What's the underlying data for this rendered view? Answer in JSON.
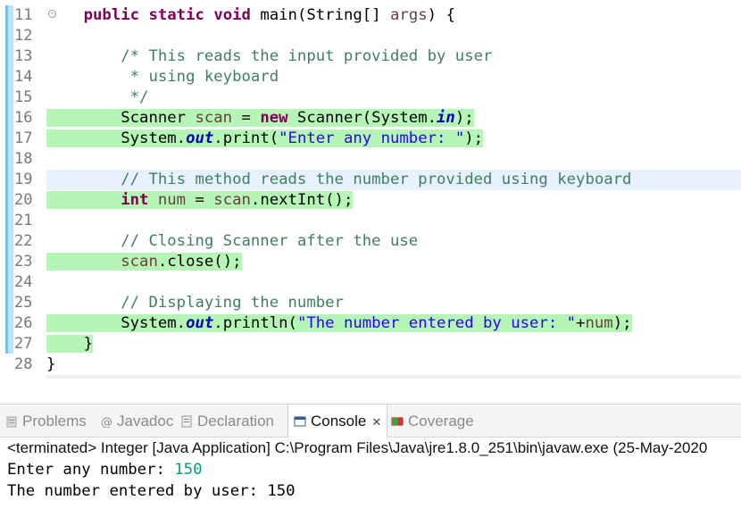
{
  "editor": {
    "lines": [
      {
        "num": "11",
        "segments": [
          {
            "t": "    "
          },
          {
            "t": "public",
            "c": "kw"
          },
          {
            "t": " "
          },
          {
            "t": "static",
            "c": "kw"
          },
          {
            "t": " "
          },
          {
            "t": "void",
            "c": "kw"
          },
          {
            "t": " main(String[] "
          },
          {
            "t": "args",
            "c": "var"
          },
          {
            "t": ") {"
          }
        ]
      },
      {
        "num": "12",
        "segments": []
      },
      {
        "num": "13",
        "segments": [
          {
            "t": "        "
          },
          {
            "t": "/* This reads the input provided by user",
            "c": "cm"
          }
        ]
      },
      {
        "num": "14",
        "segments": [
          {
            "t": "         "
          },
          {
            "t": "* using keyboard",
            "c": "cm"
          }
        ]
      },
      {
        "num": "15",
        "segments": [
          {
            "t": "         "
          },
          {
            "t": "*/",
            "c": "cm"
          }
        ]
      },
      {
        "num": "16",
        "hl": true,
        "segments": [
          {
            "t": "        Scanner "
          },
          {
            "t": "scan",
            "c": "var"
          },
          {
            "t": " = "
          },
          {
            "t": "new",
            "c": "kw"
          },
          {
            "t": " Scanner(System."
          },
          {
            "t": "in",
            "c": "fd"
          },
          {
            "t": ");"
          }
        ]
      },
      {
        "num": "17",
        "hl": true,
        "segments": [
          {
            "t": "        System."
          },
          {
            "t": "out",
            "c": "fd"
          },
          {
            "t": ".print("
          },
          {
            "t": "\"Enter any number: \"",
            "c": "st"
          },
          {
            "t": ");"
          }
        ]
      },
      {
        "num": "18",
        "segments": []
      },
      {
        "num": "19",
        "segments": [
          {
            "t": "        "
          },
          {
            "t": "// This method reads the number provided using keyboard",
            "c": "cm"
          }
        ]
      },
      {
        "num": "20",
        "hl": true,
        "segments": [
          {
            "t": "        "
          },
          {
            "t": "int",
            "c": "kw"
          },
          {
            "t": " "
          },
          {
            "t": "num",
            "c": "var"
          },
          {
            "t": " = "
          },
          {
            "t": "scan",
            "c": "var"
          },
          {
            "t": ".nextInt();"
          }
        ]
      },
      {
        "num": "21",
        "segments": []
      },
      {
        "num": "22",
        "segments": [
          {
            "t": "        "
          },
          {
            "t": "// Closing Scanner after the use",
            "c": "cm"
          }
        ]
      },
      {
        "num": "23",
        "hl": true,
        "segments": [
          {
            "t": "        "
          },
          {
            "t": "scan",
            "c": "var"
          },
          {
            "t": ".close();"
          }
        ]
      },
      {
        "num": "24",
        "segments": []
      },
      {
        "num": "25",
        "segments": [
          {
            "t": "        "
          },
          {
            "t": "// Displaying the number",
            "c": "cm"
          }
        ]
      },
      {
        "num": "26",
        "hl": true,
        "segments": [
          {
            "t": "        System."
          },
          {
            "t": "out",
            "c": "fd"
          },
          {
            "t": ".println("
          },
          {
            "t": "\"The number entered by user: \"",
            "c": "st"
          },
          {
            "t": "+"
          },
          {
            "t": "num",
            "c": "var"
          },
          {
            "t": ");"
          }
        ]
      },
      {
        "num": "27",
        "hl": true,
        "segments": [
          {
            "t": "    }"
          }
        ]
      },
      {
        "num": "28",
        "segments": [
          {
            "t": "}"
          }
        ]
      }
    ],
    "current_line": "19",
    "scroll_arrow": "<"
  },
  "panel": {
    "tabs": [
      {
        "label": "Problems",
        "icon": "problems-icon",
        "active": false
      },
      {
        "label": "Javadoc",
        "icon": "javadoc-icon",
        "active": false
      },
      {
        "label": "Declaration",
        "icon": "declaration-icon",
        "active": false
      },
      {
        "label": "Console",
        "icon": "console-icon",
        "active": true
      },
      {
        "label": "Coverage",
        "icon": "coverage-icon",
        "active": false
      }
    ],
    "close_glyph": "✕"
  },
  "console": {
    "status": "<terminated> Integer [Java Application] C:\\Program Files\\Java\\jre1.8.0_251\\bin\\javaw.exe  (25-May-2020",
    "output": [
      {
        "prompt": "Enter any number: ",
        "input": "150"
      },
      {
        "prompt": "The number entered by user: 150",
        "input": ""
      }
    ]
  },
  "colors": {
    "keyword": "#7f0055",
    "comment": "#3f7f5f",
    "string": "#2a00ff",
    "field": "#0000c0",
    "local_var": "#6a3e3e",
    "line_highlight": "#b5f5b5",
    "user_input": "#00a07a"
  }
}
